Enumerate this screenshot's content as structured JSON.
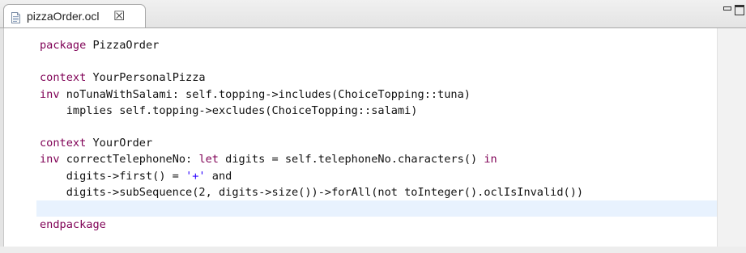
{
  "tab": {
    "title": "pizzaOrder.ocl",
    "close_glyph": "☒",
    "icon": "ocl-file-icon"
  },
  "window_controls": {
    "minimize_icon": "minimize-icon",
    "maximize_icon": "maximize-icon"
  },
  "colors": {
    "keyword": "#7f0055",
    "string": "#2a00ff",
    "current_line": "#e8f2fe"
  },
  "code": {
    "lines": [
      [
        {
          "k": "kw",
          "t": "package"
        },
        {
          "k": "",
          "t": " PizzaOrder"
        }
      ],
      [],
      [
        {
          "k": "kw",
          "t": "context"
        },
        {
          "k": "",
          "t": " YourPersonalPizza"
        }
      ],
      [
        {
          "k": "kw",
          "t": "inv"
        },
        {
          "k": "",
          "t": " noTunaWithSalami: self.topping->includes(ChoiceTopping::tuna)"
        }
      ],
      [
        {
          "k": "",
          "t": "    implies self.topping->excludes(ChoiceTopping::salami)"
        }
      ],
      [],
      [
        {
          "k": "kw",
          "t": "context"
        },
        {
          "k": "",
          "t": " YourOrder"
        }
      ],
      [
        {
          "k": "kw",
          "t": "inv"
        },
        {
          "k": "",
          "t": " correctTelephoneNo: "
        },
        {
          "k": "kw",
          "t": "let"
        },
        {
          "k": "",
          "t": " digits = self.telephoneNo.characters() "
        },
        {
          "k": "kw",
          "t": "in"
        }
      ],
      [
        {
          "k": "",
          "t": "    digits->first() = "
        },
        {
          "k": "str",
          "t": "'+'"
        },
        {
          "k": "",
          "t": " and"
        }
      ],
      [
        {
          "k": "",
          "t": "    digits->subSequence(2, digits->size())->forAll(not toInteger().oclIsInvalid())"
        }
      ],
      [],
      [
        {
          "k": "kw",
          "t": "endpackage"
        }
      ]
    ],
    "current_line_index": 10
  }
}
